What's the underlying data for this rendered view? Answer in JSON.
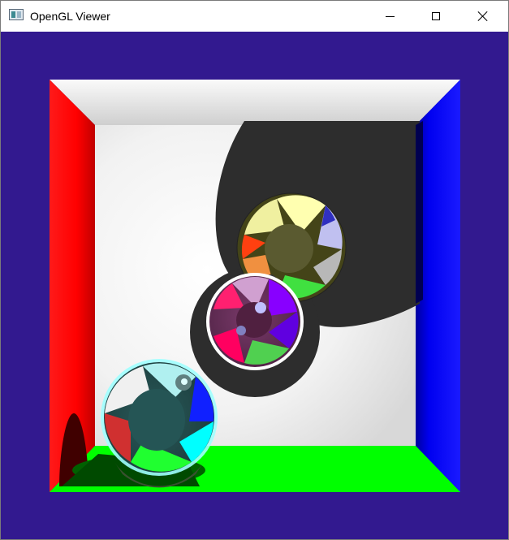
{
  "window": {
    "title": "OpenGL Viewer",
    "icon": "opengl-app-icon"
  },
  "title_controls": {
    "minimize_icon": "minimize-icon",
    "maximize_icon": "maximize-icon",
    "close_icon": "close-icon"
  },
  "scene": {
    "background_color": "#32198f",
    "left_wall_color": "#ff0000",
    "right_wall_color": "#0000ff",
    "floor_color": "#00ff00",
    "back_wall_color": "#ffffff",
    "ceiling_color": "#e8e8e8",
    "shadow_color": "#2d2d2d"
  }
}
